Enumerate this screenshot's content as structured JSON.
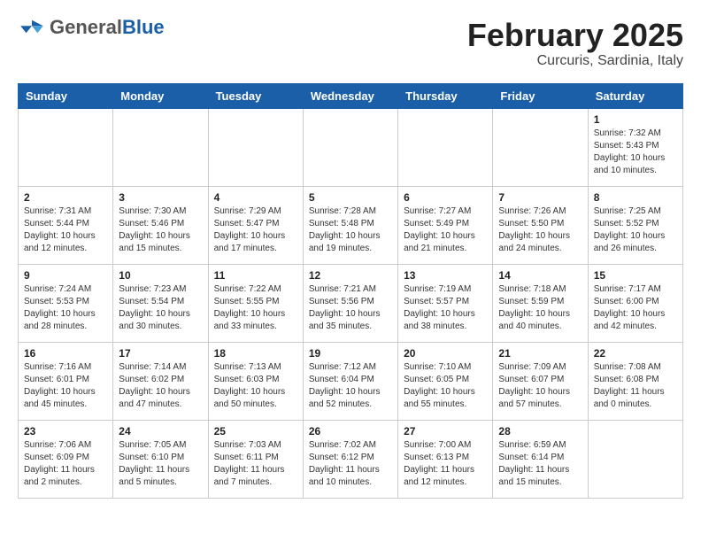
{
  "header": {
    "logo_general": "General",
    "logo_blue": "Blue",
    "month_year": "February 2025",
    "location": "Curcuris, Sardinia, Italy"
  },
  "days_of_week": [
    "Sunday",
    "Monday",
    "Tuesday",
    "Wednesday",
    "Thursday",
    "Friday",
    "Saturday"
  ],
  "weeks": [
    {
      "days": [
        {
          "num": "",
          "info": "",
          "empty": true
        },
        {
          "num": "",
          "info": "",
          "empty": true
        },
        {
          "num": "",
          "info": "",
          "empty": true
        },
        {
          "num": "",
          "info": "",
          "empty": true
        },
        {
          "num": "",
          "info": "",
          "empty": true
        },
        {
          "num": "",
          "info": "",
          "empty": true
        },
        {
          "num": "1",
          "info": "Sunrise: 7:32 AM\nSunset: 5:43 PM\nDaylight: 10 hours\nand 10 minutes.",
          "empty": false
        }
      ]
    },
    {
      "days": [
        {
          "num": "2",
          "info": "Sunrise: 7:31 AM\nSunset: 5:44 PM\nDaylight: 10 hours\nand 12 minutes.",
          "empty": false
        },
        {
          "num": "3",
          "info": "Sunrise: 7:30 AM\nSunset: 5:46 PM\nDaylight: 10 hours\nand 15 minutes.",
          "empty": false
        },
        {
          "num": "4",
          "info": "Sunrise: 7:29 AM\nSunset: 5:47 PM\nDaylight: 10 hours\nand 17 minutes.",
          "empty": false
        },
        {
          "num": "5",
          "info": "Sunrise: 7:28 AM\nSunset: 5:48 PM\nDaylight: 10 hours\nand 19 minutes.",
          "empty": false
        },
        {
          "num": "6",
          "info": "Sunrise: 7:27 AM\nSunset: 5:49 PM\nDaylight: 10 hours\nand 21 minutes.",
          "empty": false
        },
        {
          "num": "7",
          "info": "Sunrise: 7:26 AM\nSunset: 5:50 PM\nDaylight: 10 hours\nand 24 minutes.",
          "empty": false
        },
        {
          "num": "8",
          "info": "Sunrise: 7:25 AM\nSunset: 5:52 PM\nDaylight: 10 hours\nand 26 minutes.",
          "empty": false
        }
      ]
    },
    {
      "days": [
        {
          "num": "9",
          "info": "Sunrise: 7:24 AM\nSunset: 5:53 PM\nDaylight: 10 hours\nand 28 minutes.",
          "empty": false
        },
        {
          "num": "10",
          "info": "Sunrise: 7:23 AM\nSunset: 5:54 PM\nDaylight: 10 hours\nand 30 minutes.",
          "empty": false
        },
        {
          "num": "11",
          "info": "Sunrise: 7:22 AM\nSunset: 5:55 PM\nDaylight: 10 hours\nand 33 minutes.",
          "empty": false
        },
        {
          "num": "12",
          "info": "Sunrise: 7:21 AM\nSunset: 5:56 PM\nDaylight: 10 hours\nand 35 minutes.",
          "empty": false
        },
        {
          "num": "13",
          "info": "Sunrise: 7:19 AM\nSunset: 5:57 PM\nDaylight: 10 hours\nand 38 minutes.",
          "empty": false
        },
        {
          "num": "14",
          "info": "Sunrise: 7:18 AM\nSunset: 5:59 PM\nDaylight: 10 hours\nand 40 minutes.",
          "empty": false
        },
        {
          "num": "15",
          "info": "Sunrise: 7:17 AM\nSunset: 6:00 PM\nDaylight: 10 hours\nand 42 minutes.",
          "empty": false
        }
      ]
    },
    {
      "days": [
        {
          "num": "16",
          "info": "Sunrise: 7:16 AM\nSunset: 6:01 PM\nDaylight: 10 hours\nand 45 minutes.",
          "empty": false
        },
        {
          "num": "17",
          "info": "Sunrise: 7:14 AM\nSunset: 6:02 PM\nDaylight: 10 hours\nand 47 minutes.",
          "empty": false
        },
        {
          "num": "18",
          "info": "Sunrise: 7:13 AM\nSunset: 6:03 PM\nDaylight: 10 hours\nand 50 minutes.",
          "empty": false
        },
        {
          "num": "19",
          "info": "Sunrise: 7:12 AM\nSunset: 6:04 PM\nDaylight: 10 hours\nand 52 minutes.",
          "empty": false
        },
        {
          "num": "20",
          "info": "Sunrise: 7:10 AM\nSunset: 6:05 PM\nDaylight: 10 hours\nand 55 minutes.",
          "empty": false
        },
        {
          "num": "21",
          "info": "Sunrise: 7:09 AM\nSunset: 6:07 PM\nDaylight: 10 hours\nand 57 minutes.",
          "empty": false
        },
        {
          "num": "22",
          "info": "Sunrise: 7:08 AM\nSunset: 6:08 PM\nDaylight: 11 hours\nand 0 minutes.",
          "empty": false
        }
      ]
    },
    {
      "days": [
        {
          "num": "23",
          "info": "Sunrise: 7:06 AM\nSunset: 6:09 PM\nDaylight: 11 hours\nand 2 minutes.",
          "empty": false
        },
        {
          "num": "24",
          "info": "Sunrise: 7:05 AM\nSunset: 6:10 PM\nDaylight: 11 hours\nand 5 minutes.",
          "empty": false
        },
        {
          "num": "25",
          "info": "Sunrise: 7:03 AM\nSunset: 6:11 PM\nDaylight: 11 hours\nand 7 minutes.",
          "empty": false
        },
        {
          "num": "26",
          "info": "Sunrise: 7:02 AM\nSunset: 6:12 PM\nDaylight: 11 hours\nand 10 minutes.",
          "empty": false
        },
        {
          "num": "27",
          "info": "Sunrise: 7:00 AM\nSunset: 6:13 PM\nDaylight: 11 hours\nand 12 minutes.",
          "empty": false
        },
        {
          "num": "28",
          "info": "Sunrise: 6:59 AM\nSunset: 6:14 PM\nDaylight: 11 hours\nand 15 minutes.",
          "empty": false
        },
        {
          "num": "",
          "info": "",
          "empty": true
        }
      ]
    }
  ]
}
